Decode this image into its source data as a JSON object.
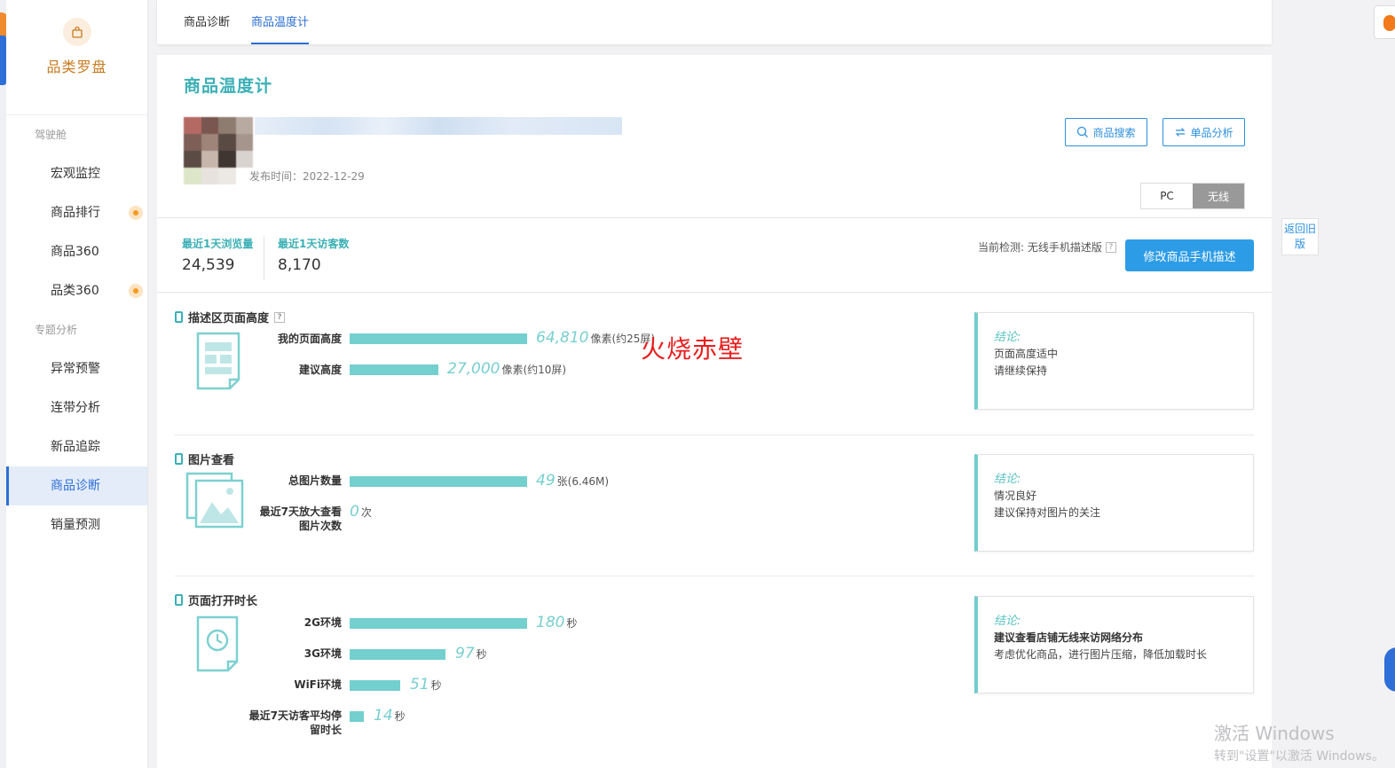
{
  "sidebar": {
    "brand_title": "品类罗盘",
    "group1": "驾驶舱",
    "items1": [
      "宏观监控",
      "商品排行",
      "商品360",
      "品类360"
    ],
    "group2": "专题分析",
    "items2": [
      "异常预警",
      "连带分析",
      "新品追踪",
      "商品诊断",
      "销量预测"
    ]
  },
  "tabs": [
    "商品诊断",
    "商品温度计"
  ],
  "page": {
    "title": "商品温度计",
    "publish_time": "发布时间：2022-12-29",
    "btn_search": "商品搜索",
    "btn_single": "单品分析",
    "seg_pc": "PC",
    "seg_wireless": "无线",
    "stat1_label": "最近1天浏览量",
    "stat1_value": "24,539",
    "stat2_label": "最近1天访客数",
    "stat2_value": "8,170",
    "detect_text": "当前检测: 无线手机描述版",
    "btn_modify": "修改商品手机描述"
  },
  "sections": [
    {
      "title": "描述区页面高度",
      "metrics": [
        {
          "label": "我的页面高度",
          "value": "64,810",
          "unit": "像素(约25屏)",
          "bar_fraction": 1.0
        },
        {
          "label": "建议高度",
          "value": "27,000",
          "unit": "像素(约10屏)",
          "bar_fraction": 0.5
        }
      ],
      "conclusion": {
        "label": "结论:",
        "lines": [
          "页面高度适中",
          "请继续保持"
        ]
      }
    },
    {
      "title": "图片查看",
      "metrics": [
        {
          "label": "总图片数量",
          "value": "49",
          "unit": "张(6.46M)",
          "bar_fraction": 1.0
        },
        {
          "label": "最近7天放大查看图片次数",
          "value": "0",
          "unit": "次",
          "bar_fraction": 0
        }
      ],
      "conclusion": {
        "label": "结论:",
        "lines": [
          "情况良好",
          "建议保持对图片的关注"
        ]
      }
    },
    {
      "title": "页面打开时长",
      "metrics": [
        {
          "label": "2G环境",
          "value": "180",
          "unit": "秒",
          "bar_fraction": 1.0
        },
        {
          "label": "3G环境",
          "value": "97",
          "unit": "秒",
          "bar_fraction": 0.54
        },
        {
          "label": "WiFi环境",
          "value": "51",
          "unit": "秒",
          "bar_fraction": 0.29
        },
        {
          "label": "最近7天访客平均停留时长",
          "value": "14",
          "unit": "秒",
          "bar_fraction": 0.08
        }
      ],
      "conclusion": {
        "label": "结论:",
        "lines": [
          "建议查看店铺无线来访网络分布",
          "考虑优化商品，进行图片压缩，降低加载时长"
        ]
      }
    }
  ],
  "overlay_text": "火烧赤壁",
  "return_old": "返回旧版",
  "windows_activation": {
    "line1": "激活 Windows",
    "line2": "转到\"设置\"以激活 Windows。"
  },
  "colors": {
    "accent_teal": "#3bb0b6",
    "bar_teal": "#74cfcf",
    "link_blue": "#2d6fd6",
    "brand_orange": "#c77a1d"
  }
}
